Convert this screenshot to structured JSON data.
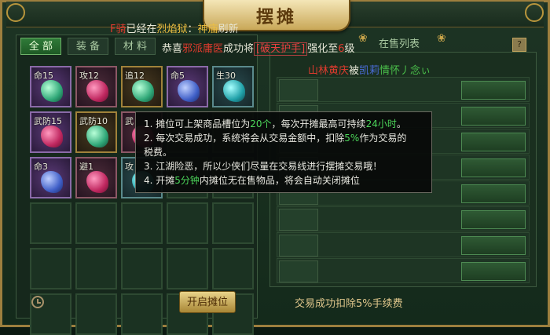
{
  "window": {
    "title": "摆摊"
  },
  "bulletin": {
    "prefix": "F骑",
    "text1": "已经在",
    "place": "烈焰狱",
    "sep": "：",
    "item": "神庙",
    "text2": "刷新"
  },
  "tabs": [
    "全 部",
    "装 备",
    "材 料"
  ],
  "congrats": {
    "text1": "恭喜",
    "player": "邪派庸医",
    "text2": "成功将",
    "item": "[破天护手]",
    "text3": "强化至",
    "level": "6",
    "text4": "级"
  },
  "on_sale_label": "在售列表",
  "help_label": "?",
  "slots": [
    {
      "label": "命15",
      "gem": "green",
      "bg": "purple"
    },
    {
      "label": "攻12",
      "gem": "pink",
      "bg": "pinkbg"
    },
    {
      "label": "追12",
      "gem": "green",
      "bg": "brownbg"
    },
    {
      "label": "命5",
      "gem": "blue",
      "bg": "purple"
    },
    {
      "label": "生30",
      "gem": "teal",
      "bg": "tealbg"
    },
    {
      "label": "武防15",
      "gem": "pink",
      "bg": "purple"
    },
    {
      "label": "武防10",
      "gem": "green",
      "bg": "brownbg"
    },
    {
      "label": "武",
      "gem": "pink",
      "bg": "pinkbg"
    },
    {
      "label": "",
      "gem": "",
      "bg": ""
    },
    {
      "label": "",
      "gem": "",
      "bg": ""
    },
    {
      "label": "命3",
      "gem": "blue",
      "bg": "purple"
    },
    {
      "label": "避1",
      "gem": "pink",
      "bg": "pinkbg"
    },
    {
      "label": "攻",
      "gem": "teal",
      "bg": "tealbg"
    },
    {
      "label": "",
      "gem": "",
      "bg": ""
    },
    {
      "label": "",
      "gem": "",
      "bg": ""
    }
  ],
  "list_title": {
    "seller": "山林黄庆",
    "text1": "被",
    "buyer": "凯莉",
    "text2": "情怀丿念",
    "suffix": "ぃ"
  },
  "tooltip": {
    "l1a": "1. 摊位可上架商品槽位为",
    "l1b": "20个",
    "l1c": "，每次开摊最高可持续",
    "l1d": "24小时",
    "l1e": "。",
    "l2a": "2. 每次交易成功，系统将会从交易金额中，扣除",
    "l2b": "5%",
    "l2c": "作为交易的",
    "l2d": "税费。",
    "l3": "3. 江湖险恶，所以少侠们尽量在交易线进行摆摊交易哦！",
    "l4a": "4. 开摊",
    "l4b": "5分钟",
    "l4c": "内摊位无在售物品，将会自动关闭摊位"
  },
  "open_button": "开启摊位",
  "fee_note": "交易成功扣除5%手续费",
  "colors": {
    "accent": "#4cd65a",
    "gold": "#f0c040",
    "red": "#e03b2e"
  }
}
